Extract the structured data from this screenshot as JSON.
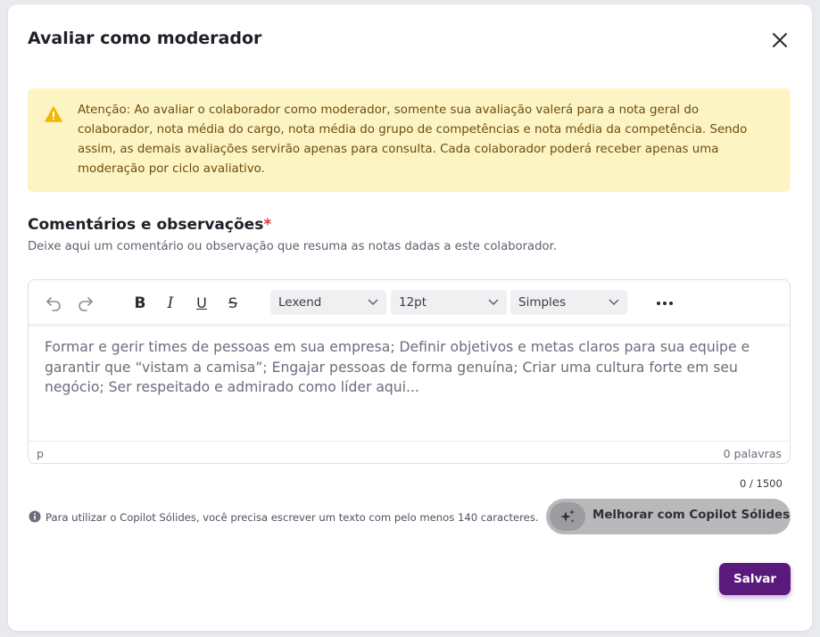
{
  "dialog": {
    "title": "Avaliar como moderador",
    "close_icon": "close-icon"
  },
  "alert": {
    "icon": "warning-icon",
    "text": "Atenção: Ao avaliar o colaborador como moderador, somente sua avaliação valerá para a nota geral do colaborador, nota média do cargo, nota média do grupo de competências e nota média da competência. Sendo assim, as demais avaliações servirão apenas para consulta. Cada colaborador poderá receber apenas uma moderação por ciclo avaliativo.",
    "colors": {
      "background": "#fdf4c4",
      "text": "#6a4e0e",
      "icon": "#f2b705"
    }
  },
  "comments": {
    "title": "Comentários e observações",
    "required_mark": "*",
    "description": "Deixe aqui um comentário ou observação que resuma as notas dadas a este colaborador."
  },
  "editor": {
    "toolbar": {
      "undo_icon": "undo-icon",
      "redo_icon": "redo-icon",
      "bold": "B",
      "italic": "I",
      "underline": "U",
      "strikethrough": "S",
      "font_family": "Lexend",
      "font_size": "12pt",
      "line_style": "Simples",
      "more_icon": "more-horizontal-icon"
    },
    "placeholder": "Formar e gerir times de pessoas em sua empresa; Definir objetivos e metas claros para sua equipe e garantir que “vistam a camisa”; Engajar pessoas de forma genuína; Criar uma cultura forte em seu negócio; Ser respeitado e admirado como líder aqui...",
    "status_path": "p",
    "word_count": "0 palavras"
  },
  "char_counter": "0 / 1500",
  "copilot": {
    "info": "Para utilizar o Copilot Sólides, você precisa escrever um texto com pelo menos 140 caracteres.",
    "button_label": "Melhorar com Copilot Sólides",
    "icon": "sparkles-icon"
  },
  "actions": {
    "save_label": "Salvar",
    "save_color": "#5a1a7c"
  }
}
